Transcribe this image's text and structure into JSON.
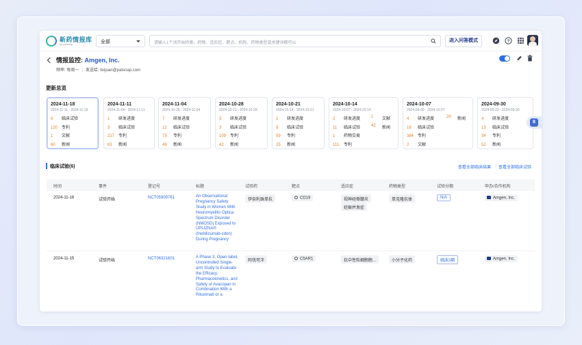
{
  "topbar": {
    "logo_text": "新药情报库",
    "logo_sub": "by patsnap",
    "scope_value": "全部",
    "search_placeholder": "请输入1个词开始检索。药物、适应症、靶点、机构、药物类型或关键词都可以",
    "qa_button": "进入问答模式"
  },
  "header": {
    "title_prefix": "情报监控:",
    "company": "Amgen, Inc.",
    "frequency": "频率: 每周一",
    "sender": "发送给: lixijuan@patsnap.com",
    "toggle_on": true
  },
  "summary": {
    "section_title": "更新总览",
    "cards": [
      {
        "date": "2024-11-18",
        "range": "2024-11-11 - 2024-11-18",
        "active": true,
        "rows": [
          [
            "6",
            "临床试验"
          ],
          [
            "120",
            "专利"
          ],
          [
            "1",
            "文献"
          ],
          [
            "60",
            "新闻"
          ]
        ],
        "extra": []
      },
      {
        "date": "2024-11-11",
        "range": "2024-11-04 - 2024-11-11",
        "active": false,
        "rows": [
          [
            "1",
            "研发进度"
          ],
          [
            "3",
            "临床试验"
          ],
          [
            "217",
            "专利"
          ],
          [
            "63",
            "新闻"
          ]
        ],
        "extra": []
      },
      {
        "date": "2024-11-04",
        "range": "2024-10-28 - 2024-11-04",
        "active": false,
        "rows": [
          [
            "7",
            "研发进度"
          ],
          [
            "12",
            "临床试验"
          ],
          [
            "73",
            "专利"
          ],
          [
            "49",
            "新闻"
          ]
        ],
        "extra": []
      },
      {
        "date": "2024-10-28",
        "range": "2024-10-21 - 2024-10-28",
        "active": false,
        "rows": [
          [
            "3",
            "研发进度"
          ],
          [
            "3",
            "临床试验"
          ],
          [
            "109",
            "专利"
          ],
          [
            "42",
            "新闻"
          ]
        ],
        "extra": []
      },
      {
        "date": "2024-10-21",
        "range": "2024-10-14 - 2024-10-21",
        "active": false,
        "rows": [
          [
            "1",
            "研发进度"
          ],
          [
            "9",
            "临床试验"
          ],
          [
            "59",
            "专利"
          ],
          [
            "25",
            "新闻"
          ]
        ],
        "extra": []
      },
      {
        "date": "2024-10-14",
        "range": "2024-10-07 - 2024-10-14",
        "active": false,
        "rows": [
          [
            "2",
            "研发进度"
          ],
          [
            "11",
            "临床试验"
          ],
          [
            "1",
            "药物交易"
          ],
          [
            "111",
            "专利"
          ]
        ],
        "extra": [
          [
            "1",
            "文献"
          ],
          [
            "42",
            "新闻"
          ]
        ]
      },
      {
        "date": "2024-10-07",
        "range": "2024-09-30 - 2024-10-07",
        "active": false,
        "rows": [
          [
            "4",
            "研发进度"
          ],
          [
            "18",
            "临床试验"
          ],
          [
            "384",
            "专利"
          ],
          [
            "2",
            "文献"
          ]
        ],
        "extra": [
          [
            "20",
            "新闻"
          ]
        ]
      },
      {
        "date": "2024-09-30",
        "range": "2024-09-23 - 2024-09-30",
        "active": false,
        "rows": [
          [
            "4",
            "研发进度"
          ],
          [
            "13",
            "临床试验"
          ],
          [
            "34",
            "专利"
          ],
          [
            "52",
            "新闻"
          ]
        ],
        "extra": []
      }
    ],
    "side_badge": "8"
  },
  "trials": {
    "title": "临床试验(6)",
    "link_results": "查看全部临床结果",
    "link_all": "查看全部临床试验",
    "columns": [
      "时间",
      "事件",
      "登记号",
      "标题",
      "试验药",
      "靶点",
      "适应症",
      "药物类型",
      "试验分期",
      "申办/合作机构"
    ],
    "rows": [
      {
        "date": "2024-11-16",
        "event": "试验开始",
        "reg_no": "NCT05909761",
        "title": "An Observational Pregnancy Safety Study in Women With Neuromyelitis Optica Spectrum Disorder (NMOSD) Exposed to UPLIZNA® (Inebilizumab-cdon) During Pregnancy",
        "drug": "伊奈利珠单抗",
        "target": "CD19",
        "indications": [
          "视神经脊髓炎",
          "妊娠并发症"
        ],
        "drug_type": "单克隆抗体",
        "phase": "N/A",
        "sponsor": "Amgen, Inc."
      },
      {
        "date": "2024-11-15",
        "event": "试验开始",
        "reg_no": "NCT06321601",
        "title": "A Phase 3, Open-label, Uncontrolled Single-arm Study to Evaluate the Efficacy, Pharmacokinetics, and Safety of Avacopan in Combination With a Rituximab or a",
        "drug": "阿伐可泮",
        "target": "C5AR1",
        "indications": [
          "抗中性粒细胞胞..."
        ],
        "drug_type": "小分子化药",
        "phase": "临床3期",
        "sponsor": "Amgen, Inc."
      }
    ]
  }
}
